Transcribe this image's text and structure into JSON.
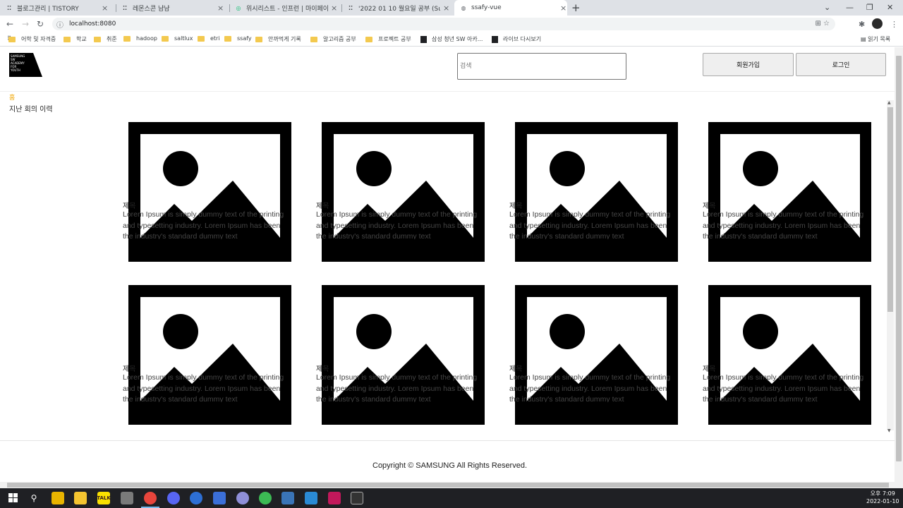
{
  "browser": {
    "tabs": [
      {
        "title": "블로그관리 | TISTORY",
        "favicon": "tistory-icon",
        "active": false
      },
      {
        "title": "레몬스콘 냠냠",
        "favicon": "tistory-icon",
        "active": false
      },
      {
        "title": "위시리스트 - 인프런 | 마이페이지",
        "favicon": "inflearn-icon",
        "active": false
      },
      {
        "title": "'2022 01 10 월요일 공부 (Sub P",
        "favicon": "tistory-icon",
        "active": false
      },
      {
        "title": "ssafy-vue",
        "favicon": "globe-icon",
        "active": true
      }
    ],
    "url": "localhost:8080",
    "bookmarks": [
      {
        "label": "어학 및 자격증",
        "type": "folder"
      },
      {
        "label": "학교",
        "type": "folder"
      },
      {
        "label": "취준",
        "type": "folder"
      },
      {
        "label": "hadoop",
        "type": "folder"
      },
      {
        "label": "saltlux",
        "type": "folder"
      },
      {
        "label": "etri",
        "type": "folder"
      },
      {
        "label": "ssafy",
        "type": "folder"
      },
      {
        "label": "안까먹게 기록",
        "type": "folder"
      },
      {
        "label": "알고리즘 공부",
        "type": "folder"
      },
      {
        "label": "프로젝트 공부",
        "type": "folder"
      },
      {
        "label": "삼성 청년 SW 아카...",
        "type": "page"
      },
      {
        "label": "라이브 다시보기",
        "type": "page"
      }
    ],
    "reading_list": "읽기 목록"
  },
  "header": {
    "logo_lines": [
      "SAMSUNG",
      "SW",
      "ACADEMY",
      "FOR",
      "YOUTH"
    ],
    "search_placeholder": "검색",
    "signup_label": "회원가입",
    "login_label": "로그인"
  },
  "breadcrumb": "홈",
  "section_title": "지난 회의 이력",
  "cards": [
    {
      "title": "제목",
      "description": "Lorem Ipsum is simply dummy text of the printing and typesetting industry. Lorem Ipsum has been the industry's standard dummy text"
    },
    {
      "title": "제목",
      "description": "Lorem Ipsum is simply dummy text of the printing and typesetting industry. Lorem Ipsum has been the industry's standard dummy text"
    },
    {
      "title": "제목",
      "description": "Lorem Ipsum is simply dummy text of the printing and typesetting industry. Lorem Ipsum has been the industry's standard dummy text"
    },
    {
      "title": "제목",
      "description": "Lorem Ipsum is simply dummy text of the printing and typesetting industry. Lorem Ipsum has been the industry's standard dummy text"
    },
    {
      "title": "제목",
      "description": "Lorem Ipsum is simply dummy text of the printing and typesetting industry. Lorem Ipsum has been the industry's standard dummy text"
    },
    {
      "title": "제목",
      "description": "Lorem Ipsum is simply dummy text of the printing and typesetting industry. Lorem Ipsum has been the industry's standard dummy text"
    },
    {
      "title": "제목",
      "description": "Lorem Ipsum is simply dummy text of the printing and typesetting industry. Lorem Ipsum has been the industry's standard dummy text"
    },
    {
      "title": "제목",
      "description": "Lorem Ipsum is simply dummy text of the printing and typesetting industry. Lorem Ipsum has been the industry's standard dummy text"
    }
  ],
  "footer": "Copyright © SAMSUNG All Rights Reserved.",
  "taskbar": {
    "time": "오후 7:09",
    "date": "2022-01-10",
    "icons": [
      "search-icon",
      "file-explorer-icon",
      "kakaotalk-icon",
      "app-icon",
      "chrome-icon",
      "discord-icon",
      "app-icon",
      "app-icon",
      "app-icon",
      "app-icon",
      "app-icon",
      "vscode-icon",
      "intellij-icon",
      "terminal-icon"
    ]
  },
  "colors": {
    "breadcrumb": "#f0a500",
    "taskbar": "#1f2024",
    "tabstrip": "#dee1e6"
  }
}
